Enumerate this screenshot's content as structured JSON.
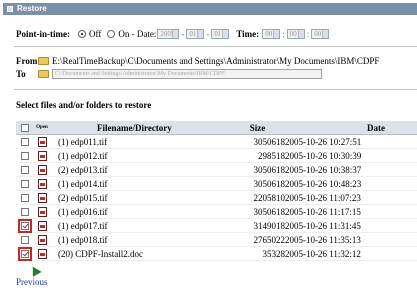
{
  "panel": {
    "title": "Restore"
  },
  "pit": {
    "label": "Point-in-time:",
    "off_label": "Off",
    "on_label": "On - Date:",
    "date_year": "2005",
    "date_month": "01",
    "date_day": "01",
    "time_label": "Time:",
    "time_hour": "00",
    "time_min": "00",
    "time_sec": "00",
    "selected": "Off"
  },
  "paths": {
    "from_label": "From",
    "from_value": "E:\\RealTimeBackup\\C\\Documents and Settings\\Administrator\\My Documents\\IBM\\CDPF",
    "to_label": "To",
    "to_value": "C:\\Documents and Settings\\Administrator\\My Documents\\IBM\\CDPF\\"
  },
  "select_title": "Select files and/or folders to restore",
  "table": {
    "headers": {
      "open": "Open",
      "name": "Filename/Directory",
      "size": "Size",
      "date": "Date"
    },
    "rows": [
      {
        "name": "(1) edp011.tif",
        "size": "3050618",
        "date": "2005-10-26 10:27:51",
        "checked": false
      },
      {
        "name": "(1) edp012.tif",
        "size": "298518",
        "date": "2005-10-26 10:30:39",
        "checked": false
      },
      {
        "name": "(2) edp013.tif",
        "size": "3050618",
        "date": "2005-10-26 10:38:37",
        "checked": false
      },
      {
        "name": "(1) edp014.tif",
        "size": "3050618",
        "date": "2005-10-26 10:48:23",
        "checked": false
      },
      {
        "name": "(2) edp015.tif",
        "size": "2205810",
        "date": "2005-10-26 11:07:23",
        "checked": false
      },
      {
        "name": "(1) edp016.tif",
        "size": "3050618",
        "date": "2005-10-26 11:17:15",
        "checked": false
      },
      {
        "name": "(1) edp017.tif",
        "size": "3149018",
        "date": "2005-10-26 11:31:45",
        "checked": true
      },
      {
        "name": "(1) edp018.tif",
        "size": "2765022",
        "date": "2005-10-26 11:35:13",
        "checked": false
      },
      {
        "name": "(20) CDPF-Install2.doc",
        "size": "35328",
        "date": "2005-10-26 11:32:12",
        "checked": true
      }
    ]
  },
  "footer": {
    "previous_label": "Previous"
  },
  "colors": {
    "title_bar": "#7a8fa8",
    "header_bg": "#dde2ea",
    "highlight": "#c62828",
    "link": "#1a3fa0"
  },
  "icons": {
    "open_file": "document-icon",
    "folder": "folder-icon"
  }
}
